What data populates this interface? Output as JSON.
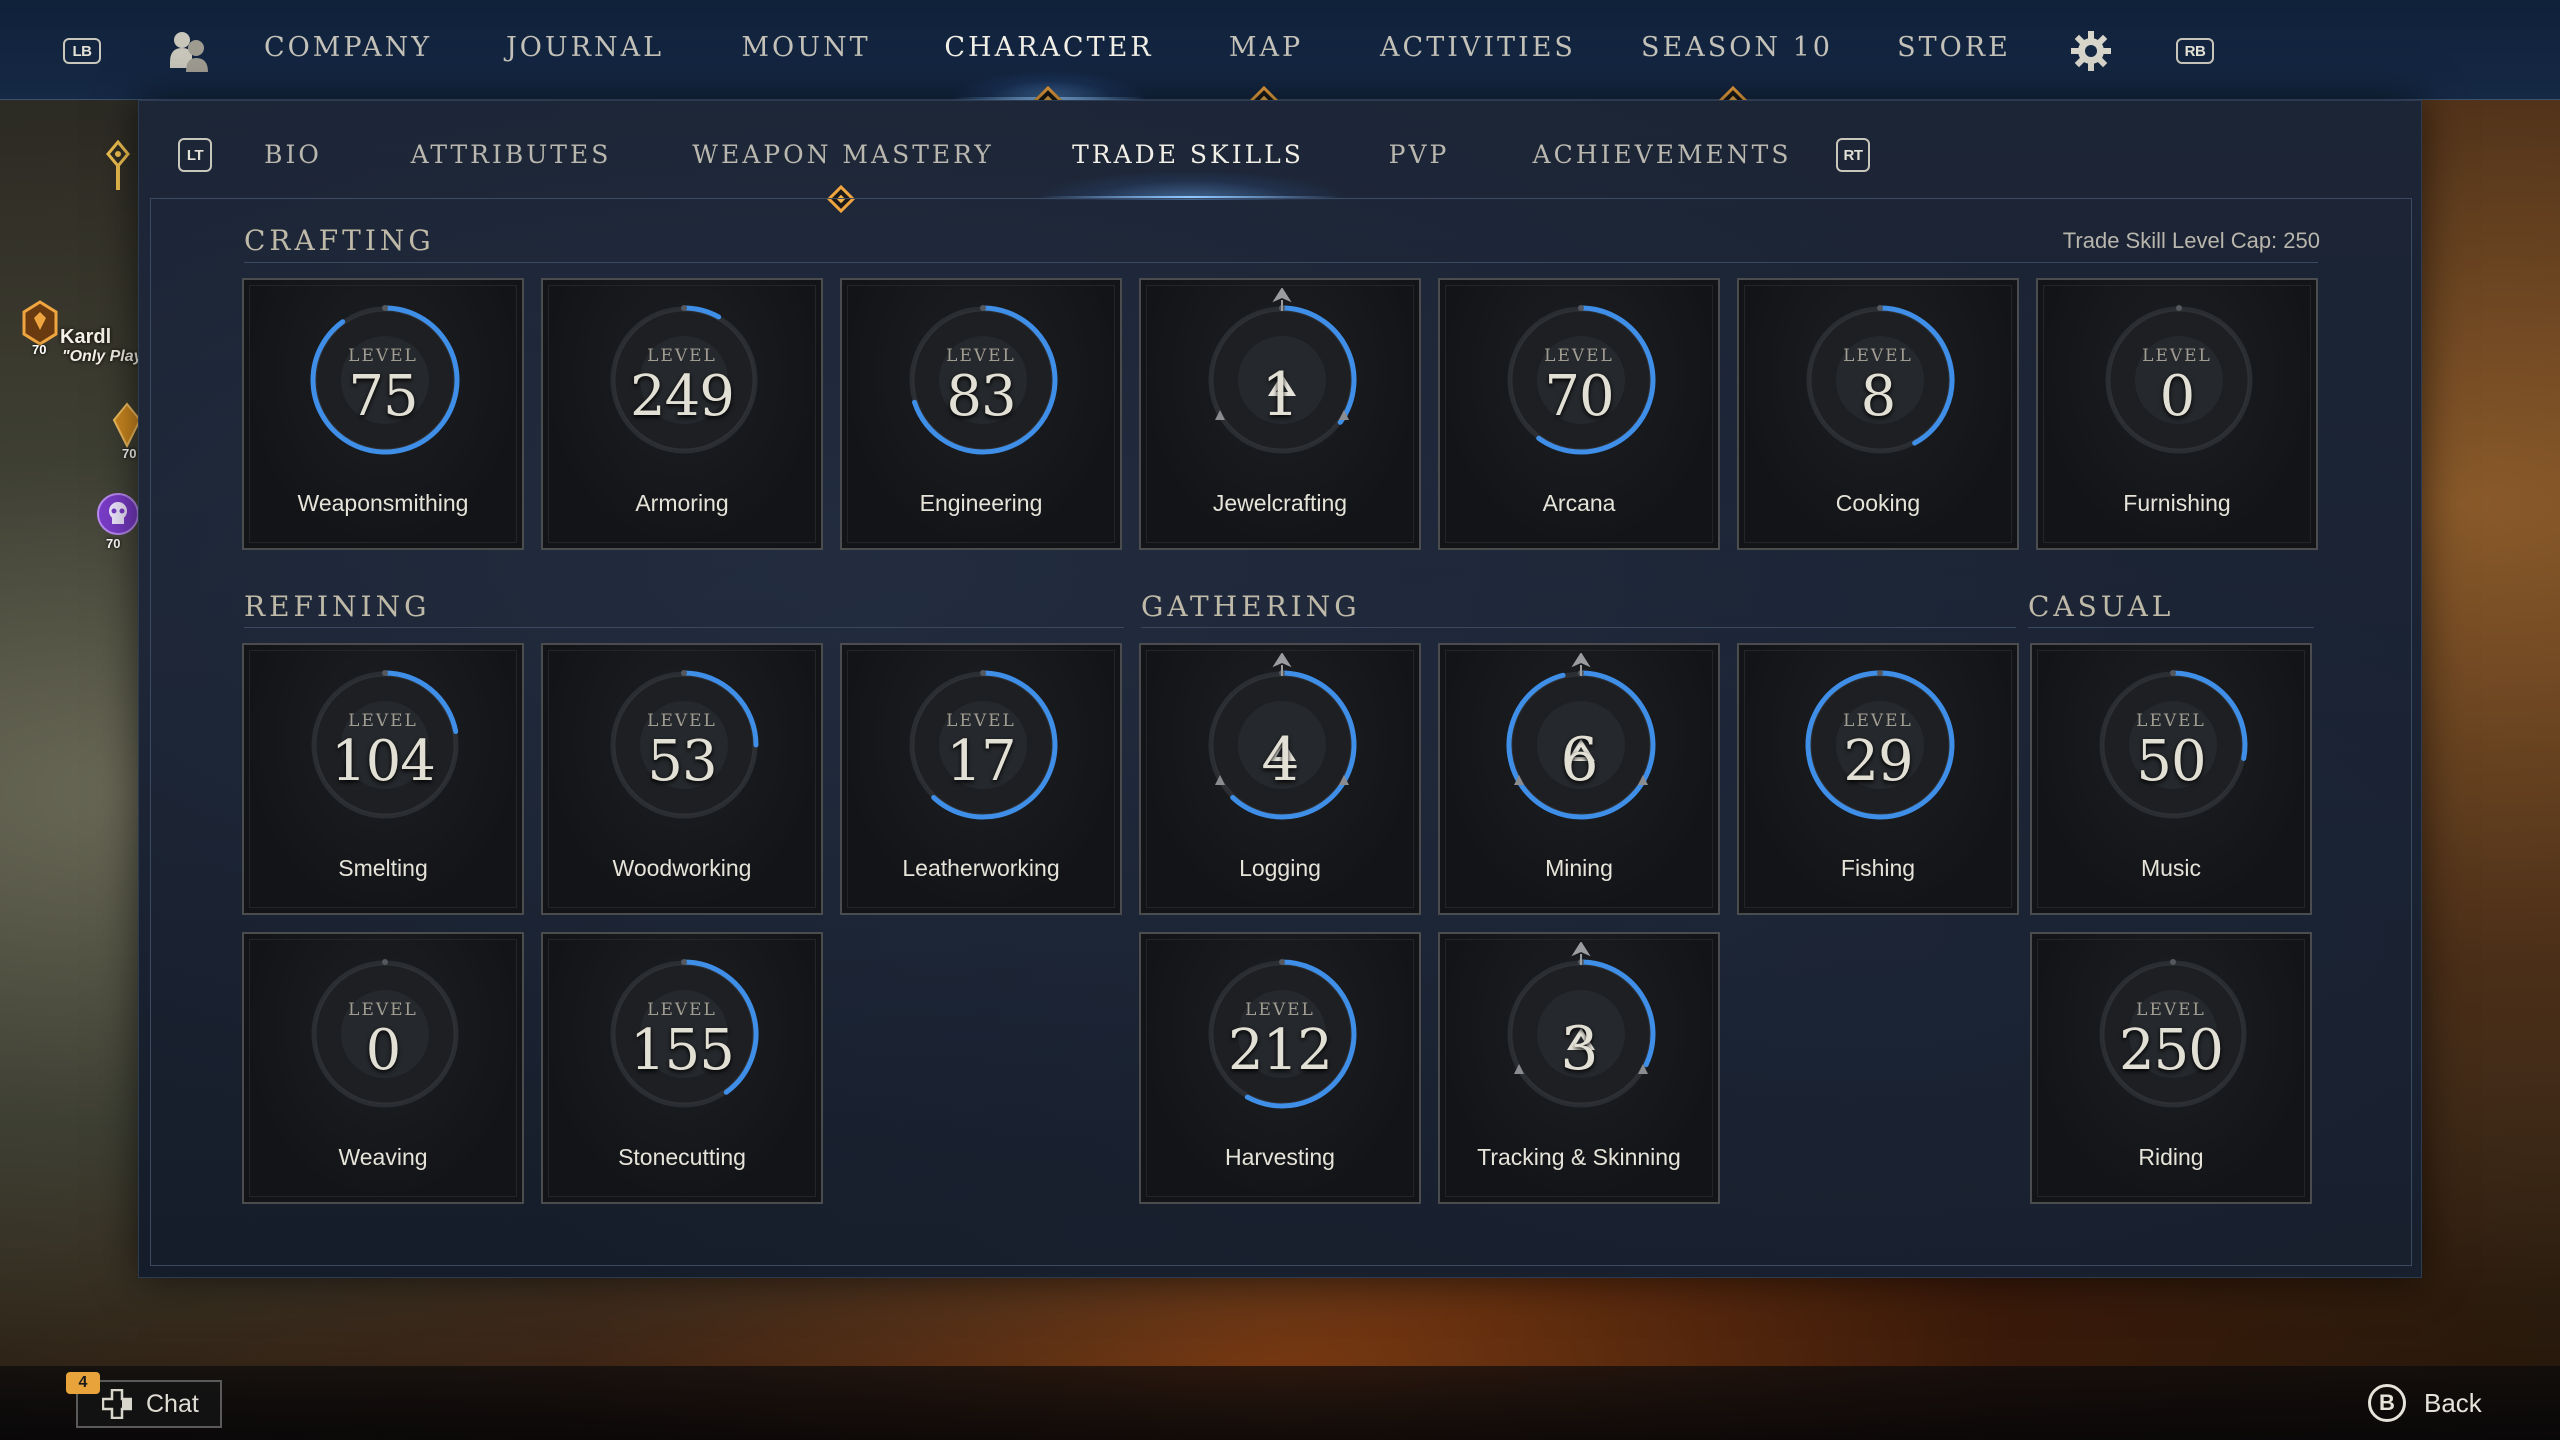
{
  "topnav": {
    "left_bumper": "LB",
    "right_bumper": "RB",
    "items": [
      "COMPANY",
      "JOURNAL",
      "MOUNT",
      "CHARACTER",
      "MAP",
      "ACTIVITIES",
      "SEASON 10",
      "STORE"
    ],
    "active": "CHARACTER"
  },
  "subnav": {
    "left_trigger": "LT",
    "right_trigger": "RT",
    "items": [
      "BIO",
      "ATTRIBUTES",
      "WEAPON MASTERY",
      "TRADE SKILLS",
      "PVP",
      "ACHIEVEMENTS"
    ],
    "active": "TRADE SKILLS"
  },
  "level_label": "LEVEL",
  "level_cap": "Trade Skill Level Cap: 250",
  "sections": {
    "crafting": "CRAFTING",
    "refining": "REFINING",
    "gathering": "GATHERING",
    "casual": "CASUAL"
  },
  "skills": {
    "crafting": [
      {
        "name": "Weaponsmithing",
        "level": "75",
        "progress": 0.9
      },
      {
        "name": "Armoring",
        "level": "249",
        "progress": 0.08
      },
      {
        "name": "Engineering",
        "level": "83",
        "progress": 0.7
      },
      {
        "name": "Jewelcrafting",
        "level": "1",
        "progress": 0.35,
        "mastery": true
      },
      {
        "name": "Arcana",
        "level": "70",
        "progress": 0.6
      },
      {
        "name": "Cooking",
        "level": "8",
        "progress": 0.42
      },
      {
        "name": "Furnishing",
        "level": "0",
        "progress": 0
      }
    ],
    "refining": [
      {
        "name": "Smelting",
        "level": "104",
        "progress": 0.22
      },
      {
        "name": "Woodworking",
        "level": "53",
        "progress": 0.25
      },
      {
        "name": "Leatherworking",
        "level": "17",
        "progress": 0.62
      },
      {
        "name": "Weaving",
        "level": "0",
        "progress": 0
      },
      {
        "name": "Stonecutting",
        "level": "155",
        "progress": 0.4
      }
    ],
    "gathering": [
      {
        "name": "Logging",
        "level": "4",
        "progress": 0.62,
        "mastery": true
      },
      {
        "name": "Mining",
        "level": "6",
        "progress": 0.96,
        "mastery": true
      },
      {
        "name": "Fishing",
        "level": "29",
        "progress": 1.0
      },
      {
        "name": "Harvesting",
        "level": "212",
        "progress": 0.58
      },
      {
        "name": "Tracking & Skinning",
        "level": "3",
        "progress": 0.32,
        "mastery": true
      }
    ],
    "casual": [
      {
        "name": "Music",
        "level": "50",
        "progress": 0.28
      },
      {
        "name": "Riding",
        "level": "250",
        "progress": 0
      }
    ]
  },
  "hud": {
    "player_name": "Kardl",
    "player_tag": "\"Only Play",
    "levels": [
      "70",
      "70",
      "70"
    ]
  },
  "bottom": {
    "chat_label": "Chat",
    "chat_count": "4",
    "back_key": "B",
    "back_label": "Back"
  },
  "colors": {
    "accent_blue": "#3f8fe8",
    "accent_gold": "#f0a640",
    "panel_bg": "#1a2232"
  }
}
